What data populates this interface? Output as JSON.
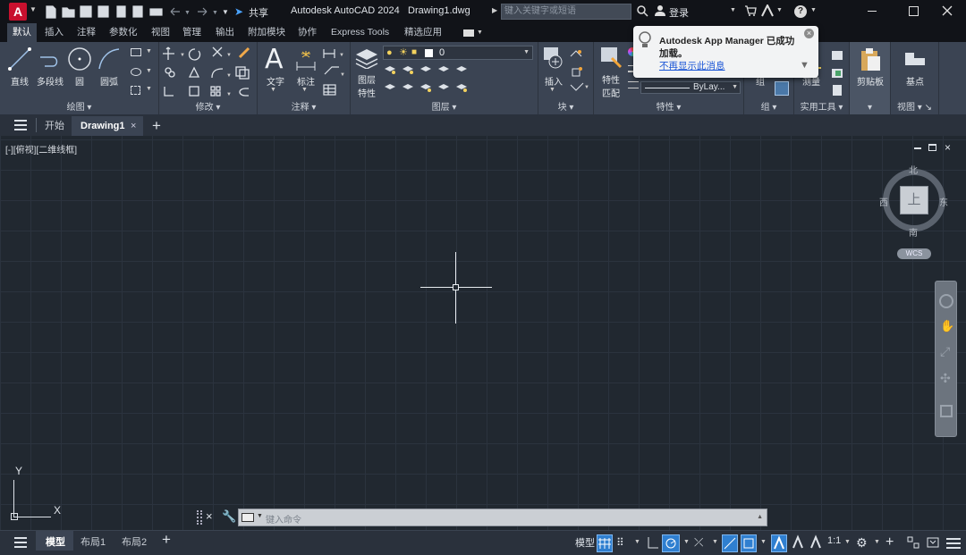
{
  "app": {
    "title": "Autodesk AutoCAD 2024",
    "file": "Drawing1.dwg",
    "logo_letter": "A"
  },
  "titlebar": {
    "share_label": "共享",
    "search_placeholder": "键入关键字或短语",
    "signin_label": "登录",
    "help_symbol": "?"
  },
  "ribbon_tabs": [
    "默认",
    "插入",
    "注释",
    "参数化",
    "视图",
    "管理",
    "输出",
    "附加模块",
    "协作",
    "Express Tools",
    "精选应用"
  ],
  "ribbon": {
    "draw": {
      "title": "绘图",
      "line": "直线",
      "polyline": "多段线",
      "circle": "圆",
      "arc": "圆弧"
    },
    "modify": {
      "title": "修改"
    },
    "annotation": {
      "title": "注释",
      "text": "文字",
      "dimension": "标注"
    },
    "layers": {
      "title": "图层",
      "layer_props_1": "图层",
      "layer_props_2": "特性",
      "current_layer": "0"
    },
    "block": {
      "title": "块",
      "insert": "插入"
    },
    "properties": {
      "title": "特性",
      "match_1": "特性",
      "match_2": "匹配",
      "linetype": "ByLay..."
    },
    "groups": {
      "title": "组",
      "group": "组"
    },
    "utilities": {
      "title": "实用工具",
      "measure": "测量"
    },
    "clipboard": {
      "title": "剪贴板"
    },
    "view": {
      "title": "视图",
      "basepoint": "基点"
    }
  },
  "notification": {
    "title": "Autodesk App Manager 已成功",
    "line2": "加载。",
    "link": "不再显示此消息"
  },
  "doc_tabs": {
    "start": "开始",
    "drawing": "Drawing1"
  },
  "viewport": {
    "label": "[-][俯视][二维线框]"
  },
  "viewcube": {
    "north": "北",
    "south": "南",
    "east": "东",
    "west": "西",
    "top": "上",
    "wcs": "WCS"
  },
  "ucs": {
    "x": "X",
    "y": "Y"
  },
  "command": {
    "placeholder": "键入命令"
  },
  "layout_tabs": {
    "model": "模型",
    "layout1": "布局1",
    "layout2": "布局2"
  },
  "status": {
    "model": "模型",
    "scale": "1:1"
  }
}
